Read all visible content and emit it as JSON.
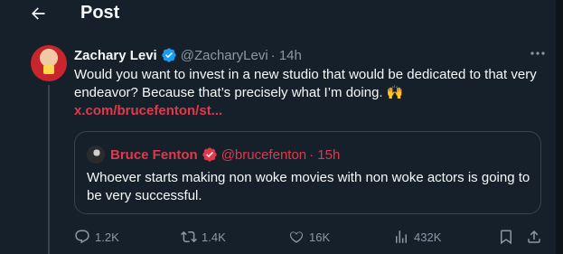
{
  "header": {
    "title": "Post"
  },
  "post": {
    "author": {
      "name": "Zachary Levi",
      "handle": "@ZacharyLevi",
      "time": "· 14h"
    },
    "text": "Would you want to invest in a new studio that would be dedicated to that very endeavor? Because that’s precisely what I’m doing.",
    "emoji": "🙌",
    "link": "x.com/brucefenton/st...",
    "quote": {
      "author": {
        "name": "Bruce Fenton",
        "handle": "@brucefenton",
        "time": "· 15h"
      },
      "text": "Whoever starts making non woke movies with non woke actors is going to be very successful."
    },
    "actions": {
      "replies": "1.2K",
      "reposts": "1.4K",
      "likes": "16K",
      "views": "432K"
    }
  },
  "colors": {
    "background": "#15202b",
    "text": "#f7f9f9",
    "muted": "#8b98a5",
    "accent_red": "#e0394c",
    "verified_blue": "#1d9bf0",
    "border": "#38444d"
  },
  "icons": [
    "back-arrow-icon",
    "verified-badge-icon",
    "more-icon",
    "reply-icon",
    "repost-icon",
    "like-icon",
    "views-icon",
    "bookmark-icon",
    "share-icon"
  ]
}
